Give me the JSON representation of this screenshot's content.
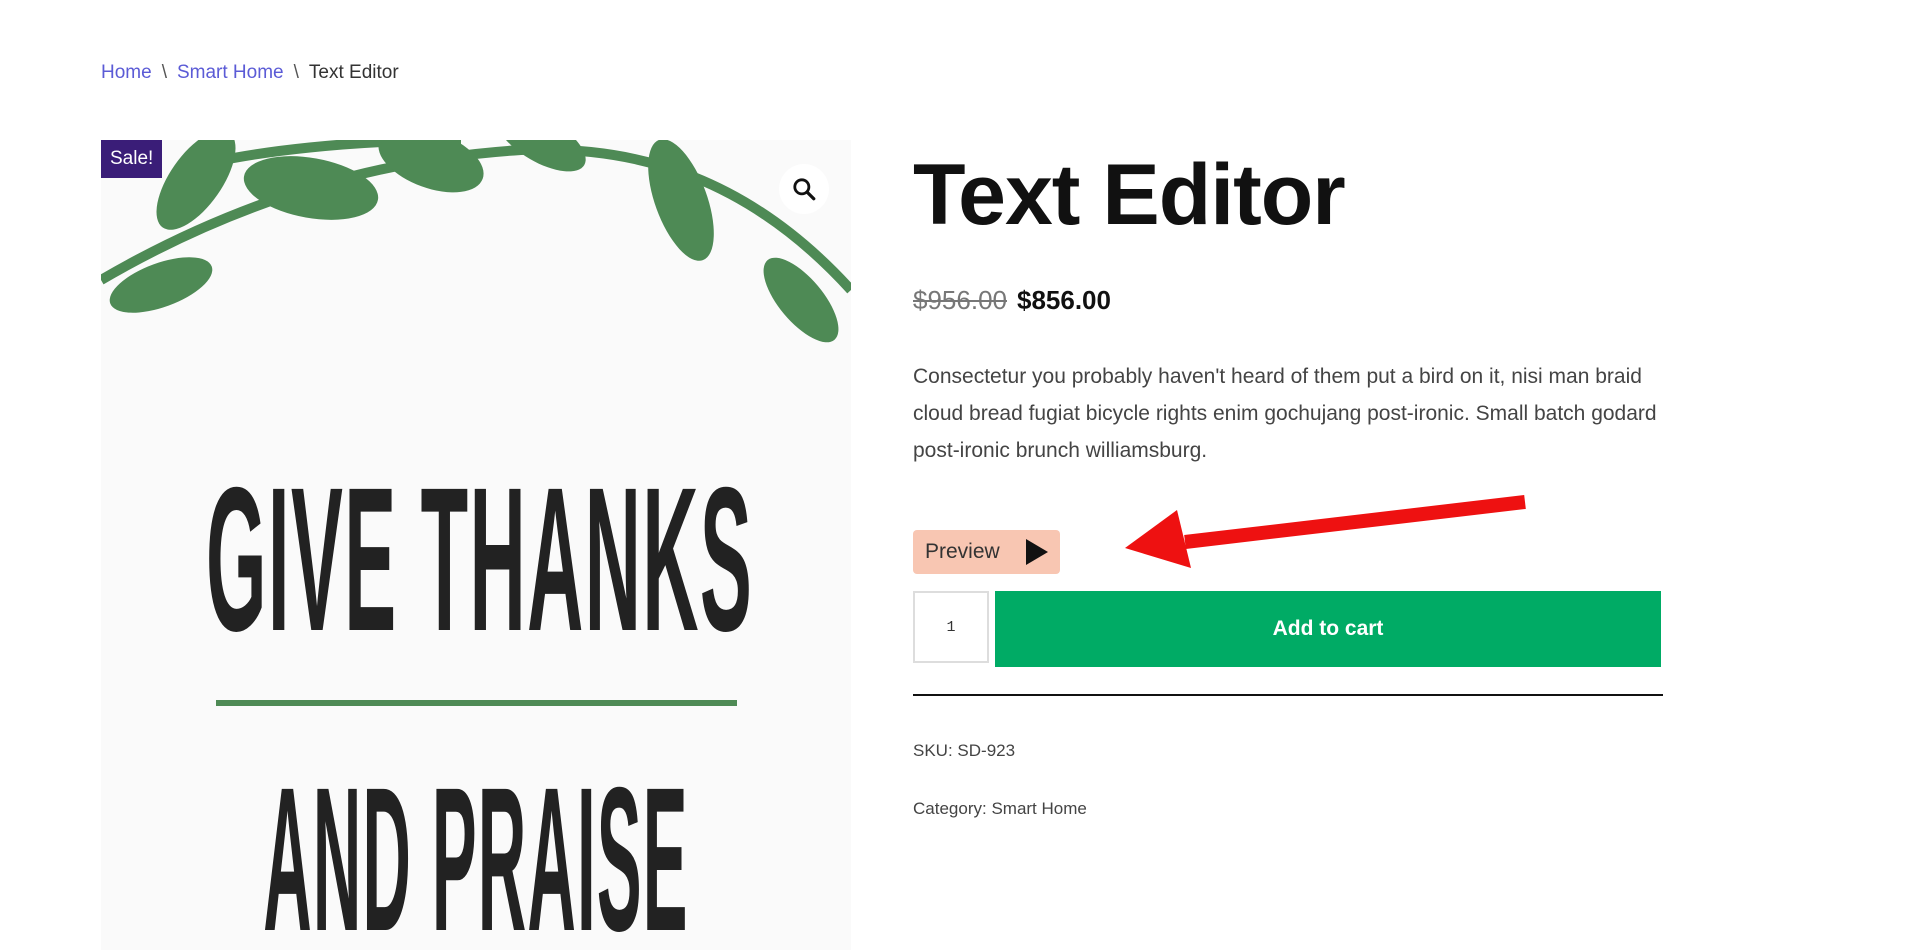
{
  "breadcrumb": {
    "items": [
      "Home",
      "Smart Home"
    ],
    "separator": "\\",
    "current": "Text Editor"
  },
  "product": {
    "badge": "Sale!",
    "zoom_icon": "magnifier-icon",
    "poster": {
      "line1": "GIVE THANKS",
      "line2": "AND PRAISE",
      "leaf_color": "#4e8a55"
    },
    "title": "Text Editor",
    "price_old": "$956.00",
    "price_new": "$856.00",
    "description": "Consectetur you probably haven't heard of them put a bird on it, nisi man braid cloud bread fugiat bicycle rights enim gochujang post-ironic. Small batch godard post-ironic brunch williamsburg.",
    "preview_label": "Preview",
    "quantity": "1",
    "add_to_cart_label": "Add to cart",
    "sku_label": "SKU:",
    "sku": "SD-923",
    "category_label": "Category:",
    "category": "Smart Home"
  },
  "colors": {
    "accent_green": "#00ab65",
    "badge_purple": "#3a1d78",
    "link_blue": "#5b5bd6",
    "preview_bg": "#f8c6b2",
    "arrow_red": "#ee1111"
  }
}
